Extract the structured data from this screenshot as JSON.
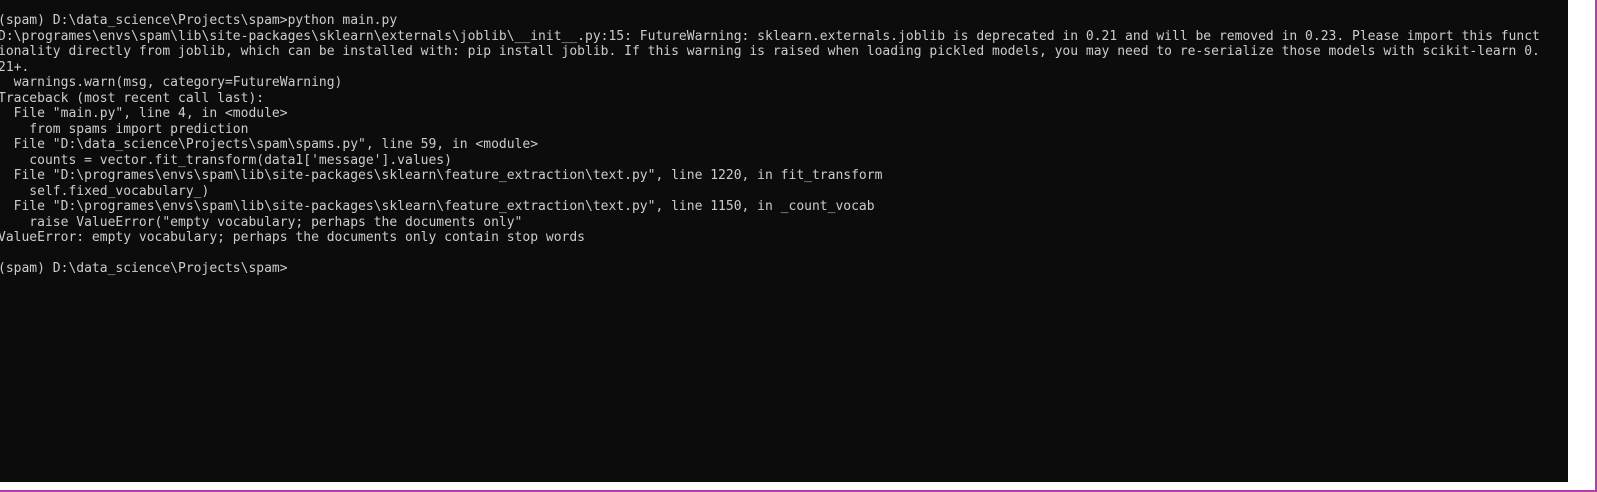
{
  "terminal": {
    "lines": [
      "(spam) D:\\data_science\\Projects\\spam>python main.py",
      "D:\\programes\\envs\\spam\\lib\\site-packages\\sklearn\\externals\\joblib\\__init__.py:15: FutureWarning: sklearn.externals.joblib is deprecated in 0.21 and will be removed in 0.23. Please import this funct",
      "ionality directly from joblib, which can be installed with: pip install joblib. If this warning is raised when loading pickled models, you may need to re-serialize those models with scikit-learn 0.",
      "21+.",
      "  warnings.warn(msg, category=FutureWarning)",
      "Traceback (most recent call last):",
      "  File \"main.py\", line 4, in <module>",
      "    from spams import prediction",
      "  File \"D:\\data_science\\Projects\\spam\\spams.py\", line 59, in <module>",
      "    counts = vector.fit_transform(data1['message'].values)",
      "  File \"D:\\programes\\envs\\spam\\lib\\site-packages\\sklearn\\feature_extraction\\text.py\", line 1220, in fit_transform",
      "    self.fixed_vocabulary_)",
      "  File \"D:\\programes\\envs\\spam\\lib\\site-packages\\sklearn\\feature_extraction\\text.py\", line 1150, in _count_vocab",
      "    raise ValueError(\"empty vocabulary; perhaps the documents only\"",
      "ValueError: empty vocabulary; perhaps the documents only contain stop words",
      "",
      "(spam) D:\\data_science\\Projects\\spam>"
    ]
  },
  "colors": {
    "background": "#0c0c0c",
    "text": "#cccccc",
    "frame": "#b23fb2"
  }
}
